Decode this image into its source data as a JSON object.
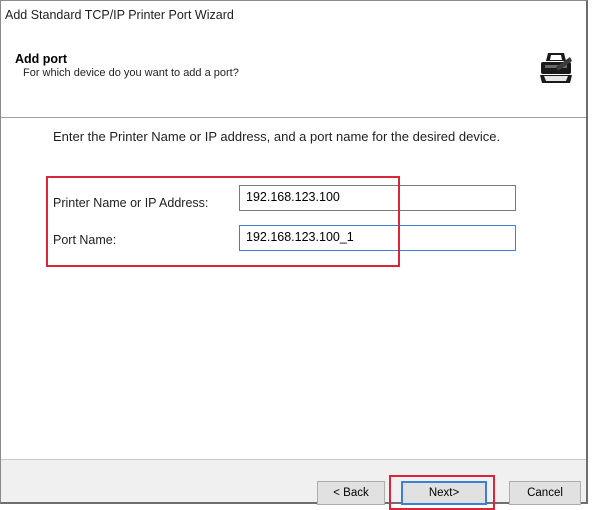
{
  "window": {
    "title": "Add Standard TCP/IP Printer Port Wizard"
  },
  "header": {
    "title": "Add port",
    "subtitle": "For which device do you want to add a port?",
    "icon": "printer-port-icon"
  },
  "main": {
    "instruction": "Enter the Printer Name or IP address, and a port name for the desired device.",
    "ip_label": "Printer Name or IP Address:",
    "ip_value": "192.168.123.100",
    "port_label": "Port Name:",
    "port_value": "192.168.123.100_1"
  },
  "footer": {
    "back_label": "< Back",
    "next_label": "Next>",
    "cancel_label": "Cancel"
  },
  "colors": {
    "highlight": "#d9263a",
    "focus": "#3c7fd6"
  }
}
